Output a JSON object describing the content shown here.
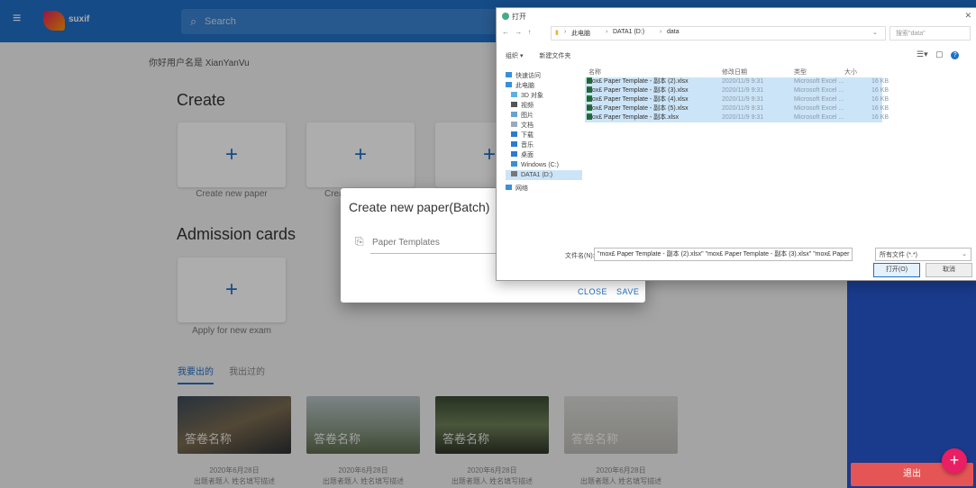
{
  "appbar": {
    "logo_text": "suxif",
    "search_placeholder": "Search"
  },
  "main": {
    "welcome": "你好用户名是 XianYanVu",
    "create_heading": "Create",
    "create_cards": [
      {
        "label": "Create new paper"
      },
      {
        "label": "Create"
      },
      {
        "label": ""
      }
    ],
    "admission_heading": "Admission cards",
    "admission_cards": [
      {
        "label": "Apply for new exam"
      }
    ],
    "tabs": [
      "我要出的",
      "我出过的"
    ],
    "thumbs": [
      {
        "overlay": "答卷名称",
        "date": "2020年6月28日",
        "desc": "出题者题人 姓名填写描述"
      },
      {
        "overlay": "答卷名称",
        "date": "2020年6月28日",
        "desc": "出题者题人 姓名填写描述"
      },
      {
        "overlay": "答卷名称",
        "date": "2020年6月28日",
        "desc": "出题者题人 姓名填写描述"
      },
      {
        "overlay": "答卷名称",
        "date": "2020年6月28日",
        "desc": "出题者题人 姓名填写描述"
      }
    ]
  },
  "right_panel": {
    "logout": "退出",
    "fab": "+"
  },
  "dialog": {
    "title": "Create new paper(Batch)",
    "input_placeholder": "Paper Templates",
    "close": "CLOSE",
    "save": "SAVE"
  },
  "file_dialog": {
    "title": "打开",
    "nav": "← → ↑",
    "path": [
      "此电脑",
      "DATA1 (D:)",
      "data"
    ],
    "search_placeholder": "搜索\"data\"",
    "toolbar": [
      "组织 ▾",
      "新建文件夹"
    ],
    "sidebar": [
      "快速访问",
      "此电脑",
      "3D 对象",
      "视频",
      "图片",
      "文档",
      "下载",
      "音乐",
      "桌面",
      "Windows (C:)",
      "DATA1 (D:)",
      "网络"
    ],
    "columns": [
      "名称",
      "修改日期",
      "类型",
      "大小"
    ],
    "files": [
      {
        "name": "mox£ Paper Template - 副本 (2).xlsx",
        "date": "2020/11/9 9:31",
        "type": "Microsoft Excel ...",
        "size": "16 KB"
      },
      {
        "name": "mox£ Paper Template - 副本 (3).xlsx",
        "date": "2020/11/9 9:31",
        "type": "Microsoft Excel ...",
        "size": "16 KB"
      },
      {
        "name": "mox£ Paper Template - 副本 (4).xlsx",
        "date": "2020/11/9 9:31",
        "type": "Microsoft Excel ...",
        "size": "16 KB"
      },
      {
        "name": "mox£ Paper Template - 副本 (5).xlsx",
        "date": "2020/11/9 9:31",
        "type": "Microsoft Excel ...",
        "size": "16 KB"
      },
      {
        "name": "mox£ Paper Template - 副本.xlsx",
        "date": "2020/11/9 9:31",
        "type": "Microsoft Excel ...",
        "size": "16 KB"
      }
    ],
    "filename_label": "文件名(N):",
    "filename_value": "\"mox£ Paper Template - 副本 (2).xlsx\" \"mox£ Paper Template - 副本 (3).xlsx\" \"mox£ Paper",
    "filetype": "所有文件 (*.*)",
    "open": "打开(O)",
    "cancel": "取消"
  }
}
